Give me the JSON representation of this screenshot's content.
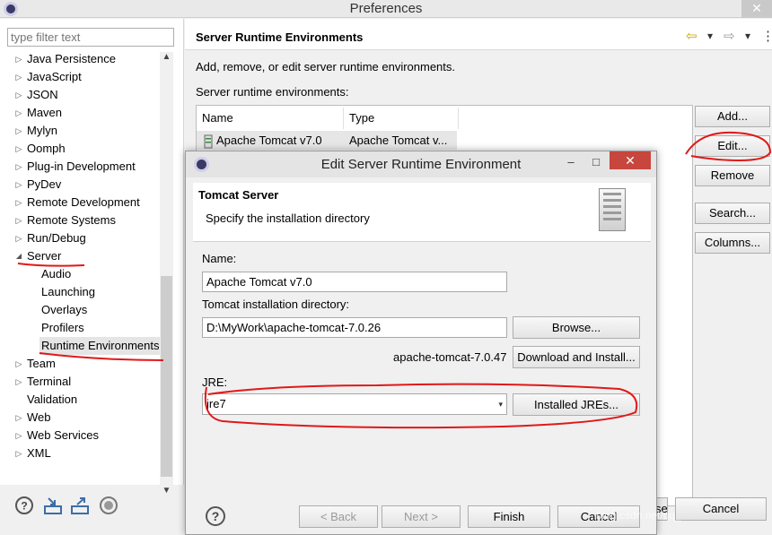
{
  "window": {
    "title": "Preferences",
    "min": "–",
    "max": "□",
    "close": "✕"
  },
  "filter": {
    "placeholder": "type filter text"
  },
  "tree": {
    "top_items": [
      {
        "label": "Java Persistence",
        "arrow": "▷"
      },
      {
        "label": "JavaScript",
        "arrow": "▷"
      },
      {
        "label": "JSON",
        "arrow": "▷"
      },
      {
        "label": "Maven",
        "arrow": "▷"
      },
      {
        "label": "Mylyn",
        "arrow": "▷"
      },
      {
        "label": "Oomph",
        "arrow": "▷"
      },
      {
        "label": "Plug-in Development",
        "arrow": "▷"
      },
      {
        "label": "PyDev",
        "arrow": "▷"
      },
      {
        "label": "Remote Development",
        "arrow": "▷"
      },
      {
        "label": "Remote Systems",
        "arrow": "▷"
      },
      {
        "label": "Run/Debug",
        "arrow": "▷"
      },
      {
        "label": "Server",
        "arrow": "◢"
      }
    ],
    "server_children": [
      "Audio",
      "Launching",
      "Overlays",
      "Profilers",
      "Runtime Environments"
    ],
    "bottom_items": [
      {
        "label": "Team",
        "arrow": "▷"
      },
      {
        "label": "Terminal",
        "arrow": "▷"
      },
      {
        "label": "Validation",
        "arrow": ""
      },
      {
        "label": "Web",
        "arrow": "▷"
      },
      {
        "label": "Web Services",
        "arrow": "▷"
      },
      {
        "label": "XML",
        "arrow": "▷"
      }
    ],
    "scroll_up": "▲",
    "scroll_down": "▼"
  },
  "right": {
    "title": "Server Runtime Environments",
    "nav": {
      "back": "⇦",
      "menu": "▾",
      "forward": "⇨",
      "forward_menu": "▾",
      "more": "⋮"
    },
    "description": "Add, remove, or edit server runtime environments.",
    "env_label": "Server runtime environments:",
    "columns": [
      "Name",
      "Type"
    ],
    "row": {
      "name": "Apache Tomcat v7.0",
      "type": "Apache Tomcat v..."
    },
    "buttons": {
      "add": "Add...",
      "edit": "Edit...",
      "remove": "Remove",
      "search": "Search...",
      "columns": "Columns..."
    },
    "close_partial": "se",
    "cancel": "Cancel"
  },
  "dialog": {
    "title": "Edit Server Runtime Environment",
    "min": "–",
    "max": "□",
    "close": "✕",
    "banner_title": "Tomcat Server",
    "banner_sub": "Specify the installation directory",
    "name_label": "Name:",
    "name_value": "Apache Tomcat v7.0",
    "dir_label": "Tomcat installation directory:",
    "dir_value": "D:\\MyWork\\apache-tomcat-7.0.26",
    "browse": "Browse...",
    "version_text": "apache-tomcat-7.0.47",
    "download": "Download and Install...",
    "jre_label": "JRE:",
    "jre_value": "jre7",
    "jre_caret": "▾",
    "installed_jres": "Installed JREs...",
    "help": "?",
    "back": "< Back",
    "next": "Next >",
    "finish": "Finish",
    "cancel": "Cancel"
  },
  "watermark": "blog.csdn.net/qq_"
}
